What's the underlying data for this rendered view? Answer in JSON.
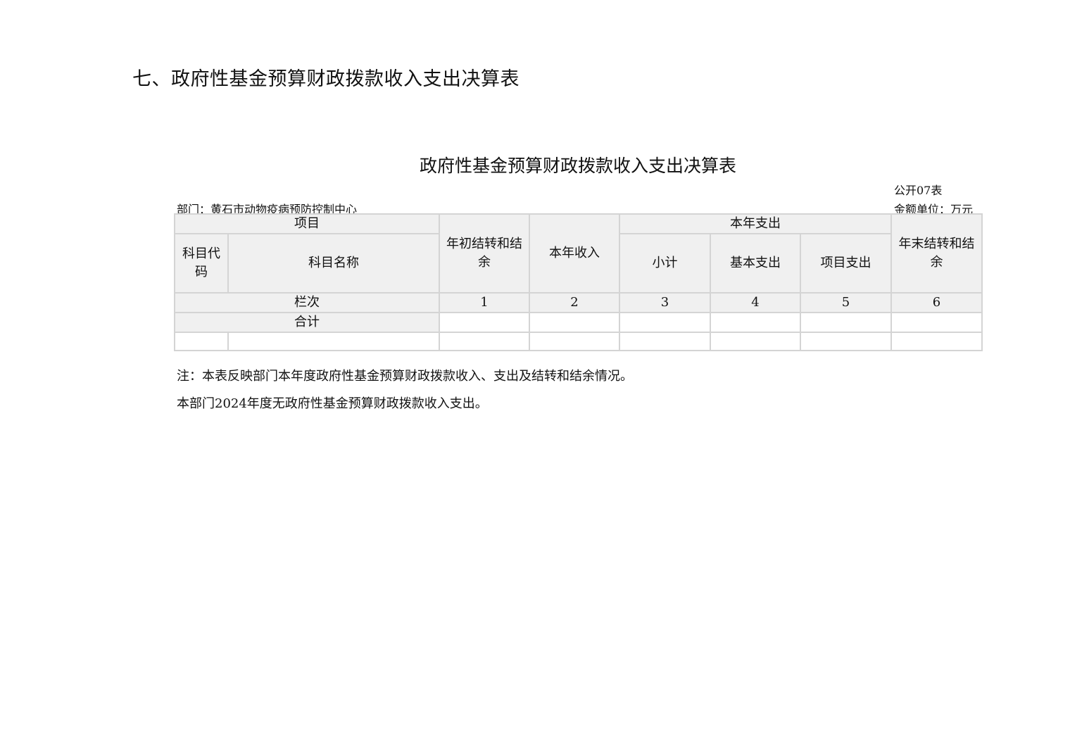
{
  "section_heading": "七、政府性基金预算财政拨款收入支出决算表",
  "table_title": "政府性基金预算财政拨款收入支出决算表",
  "form_code": "公开07表",
  "department": "部门：黄石市动物疫病预防控制中心",
  "unit": "金额单位：万元",
  "headers": {
    "project": "项目",
    "subject_code": "科目代码",
    "subject_name": "科目名称",
    "opening_balance": "年初结转和结余",
    "current_income": "本年收入",
    "current_expense": "本年支出",
    "subtotal": "小计",
    "basic_expense": "基本支出",
    "project_expense": "项目支出",
    "closing_balance": "年末结转和结余"
  },
  "column_numbers_label": "栏次",
  "column_numbers": [
    "1",
    "2",
    "3",
    "4",
    "5",
    "6"
  ],
  "total_label": "合计",
  "total_values": [
    "",
    "",
    "",
    "",
    "",
    ""
  ],
  "notes": [
    "注：本表反映部门本年度政府性基金预算财政拨款收入、支出及结转和结余情况。",
    "本部门2024年度无政府性基金预算财政拨款收入支出。"
  ]
}
